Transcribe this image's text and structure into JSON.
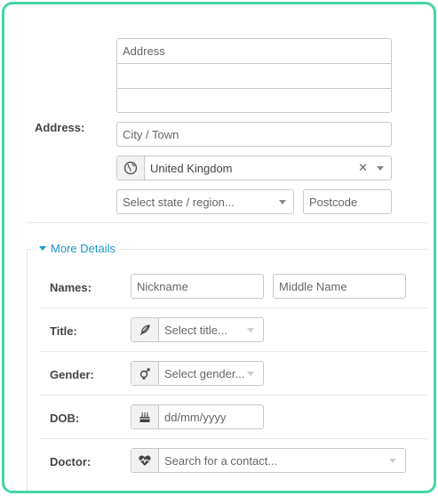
{
  "address": {
    "label": "Address:",
    "line1_placeholder": "Address",
    "city_placeholder": "City / Town",
    "country_value": "United Kingdom",
    "country_icon": "globe-icon",
    "clear_glyph": "✕",
    "state_placeholder": "Select state / region...",
    "postcode_placeholder": "Postcode"
  },
  "more_details": {
    "toggle_label": "More Details",
    "names": {
      "label": "Names:",
      "nickname_placeholder": "Nickname",
      "middle_placeholder": "Middle Name"
    },
    "title": {
      "label": "Title:",
      "placeholder": "Select title...",
      "icon": "feather-icon"
    },
    "gender": {
      "label": "Gender:",
      "placeholder": "Select gender...",
      "icon": "gender-icon"
    },
    "dob": {
      "label": "DOB:",
      "placeholder": "dd/mm/yyyy",
      "icon": "birthday-cake-icon"
    },
    "doctor": {
      "label": "Doctor:",
      "placeholder": "Search for a contact...",
      "icon": "heartbeat-icon"
    }
  },
  "colors": {
    "frame_border": "#45d5a5",
    "link": "#1897c6"
  }
}
